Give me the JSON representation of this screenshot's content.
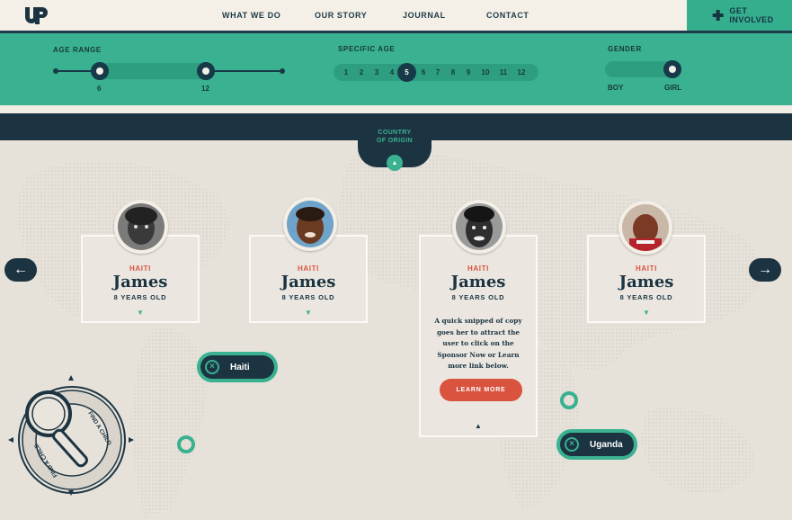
{
  "brand": {
    "logo_text": "UP",
    "colors": {
      "teal": "#3ab190",
      "navy": "#1c3442",
      "coral": "#d9533f",
      "cream": "#f5f0e7"
    }
  },
  "nav": {
    "items": [
      "WHAT WE DO",
      "OUR STORY",
      "JOURNAL",
      "CONTACT"
    ],
    "cta": "GET INVOLVED",
    "cta_icon": "plus-icon"
  },
  "filters": {
    "age_range": {
      "label": "AGE RANGE",
      "min_label": "6",
      "max_label": "12"
    },
    "specific_age": {
      "label": "SPECIFIC AGE",
      "ages": [
        "1",
        "2",
        "3",
        "4",
        "5",
        "6",
        "7",
        "8",
        "9",
        "10",
        "11",
        "12"
      ],
      "selected": "5"
    },
    "gender": {
      "label": "GENDER",
      "options": [
        "BOY",
        "GIRL"
      ],
      "selected": "GIRL"
    }
  },
  "country_tab": {
    "label_line1": "COUNTRY",
    "label_line2": "OF ORIGIN",
    "icon": "caret-up-icon"
  },
  "children": [
    {
      "country": "HAITI",
      "name": "James",
      "age": "8 YEARS OLD",
      "icon": "caret-down-icon"
    },
    {
      "country": "HAITI",
      "name": "James",
      "age": "8 YEARS OLD",
      "icon": "caret-down-icon"
    },
    {
      "country": "HAITI",
      "name": "James",
      "age": "8 YEARS OLD",
      "copy": "A quick snipped of copy goes her to attract the user to click on the Sponsor Now or Learn more link below.",
      "button": "LEARN MORE",
      "icon": "caret-up-icon"
    },
    {
      "country": "HAITI",
      "name": "James",
      "age": "8 YEARS OLD",
      "icon": "caret-down-icon"
    }
  ],
  "arrows": {
    "prev": "←",
    "next": "→"
  },
  "country_pills": [
    {
      "name": "Haiti",
      "icon": "close-icon"
    },
    {
      "name": "Uganda",
      "icon": "close-icon"
    }
  ],
  "find_badge": {
    "text": "FIND A CHILD",
    "icon": "magnifier-icon"
  }
}
